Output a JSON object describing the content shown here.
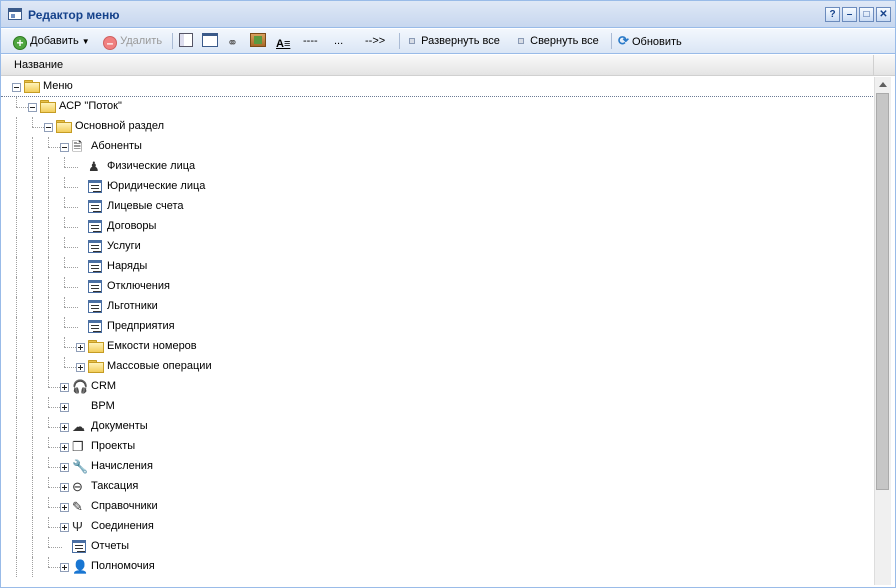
{
  "window": {
    "title": "Редактор меню",
    "buttons": {
      "help": "?",
      "minimize": "–",
      "maximize": "□",
      "close": "✕"
    }
  },
  "toolbar": {
    "add_label": "Добавить",
    "delete_label": "Удалить",
    "dashes_label": "----",
    "dots_label": "...",
    "arrow_label": "-->>",
    "expand_all_label": "Развернуть все",
    "collapse_all_label": "Свернуть все",
    "refresh_label": "Обновить"
  },
  "grid": {
    "column_header": "Название"
  },
  "tree": [
    {
      "label": "Меню",
      "level": 0,
      "expander": "minus",
      "icon": "folder-icon",
      "selected": true
    },
    {
      "label": "АСР \"Поток\"",
      "level": 1,
      "expander": "minus",
      "icon": "folder-icon"
    },
    {
      "label": "Основной раздел",
      "level": 2,
      "expander": "minus",
      "icon": "folder-icon"
    },
    {
      "label": "Абоненты",
      "level": 3,
      "expander": "minus",
      "icon": "contact-card-icon"
    },
    {
      "label": "Физические лица",
      "level": 4,
      "expander": "none",
      "icon": "person-figure-icon"
    },
    {
      "label": "Юридические лица",
      "level": 4,
      "expander": "none",
      "icon": "form-icon"
    },
    {
      "label": "Лицевые счета",
      "level": 4,
      "expander": "none",
      "icon": "form-icon"
    },
    {
      "label": "Договоры",
      "level": 4,
      "expander": "none",
      "icon": "form-icon"
    },
    {
      "label": "Услуги",
      "level": 4,
      "expander": "none",
      "icon": "form-icon"
    },
    {
      "label": "Наряды",
      "level": 4,
      "expander": "none",
      "icon": "form-icon"
    },
    {
      "label": "Отключения",
      "level": 4,
      "expander": "none",
      "icon": "form-icon"
    },
    {
      "label": "Льготники",
      "level": 4,
      "expander": "none",
      "icon": "form-icon"
    },
    {
      "label": "Предприятия",
      "level": 4,
      "expander": "none",
      "icon": "form-icon"
    },
    {
      "label": "Емкости номеров",
      "level": 4,
      "expander": "plus",
      "icon": "folder-icon"
    },
    {
      "label": "Массовые операции",
      "level": 4,
      "expander": "plus",
      "icon": "folder-icon"
    },
    {
      "label": "CRM",
      "level": 3,
      "expander": "plus",
      "icon": "headset-icon"
    },
    {
      "label": "BPM",
      "level": 3,
      "expander": "plus",
      "icon": "none"
    },
    {
      "label": "Документы",
      "level": 3,
      "expander": "plus",
      "icon": "document-icon"
    },
    {
      "label": "Проекты",
      "level": 3,
      "expander": "plus",
      "icon": "projects-icon"
    },
    {
      "label": "Начисления",
      "level": 3,
      "expander": "plus",
      "icon": "wrench-icon"
    },
    {
      "label": "Таксация",
      "level": 3,
      "expander": "plus",
      "icon": "no-entry-icon"
    },
    {
      "label": "Справочники",
      "level": 3,
      "expander": "plus",
      "icon": "pencil-icon"
    },
    {
      "label": "Соединения",
      "level": 3,
      "expander": "plus",
      "icon": "usb-icon"
    },
    {
      "label": "Отчеты",
      "level": 3,
      "expander": "none",
      "icon": "form-icon"
    },
    {
      "label": "Полномочия",
      "level": 3,
      "expander": "plus",
      "icon": "user-icon"
    }
  ]
}
